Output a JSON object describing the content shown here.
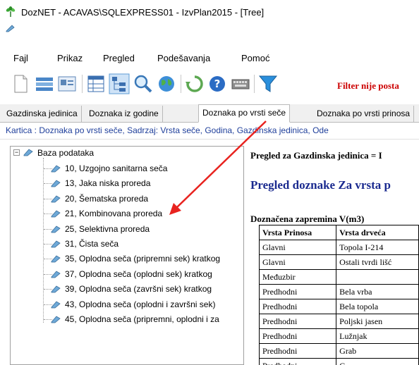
{
  "window": {
    "title": "DozNET - ACAVAS\\SQLEXPRESS01 - IzvPlan2015 - [Tree]",
    "icon": "app-leaf-icon"
  },
  "menu": {
    "items": [
      "Fajl",
      "Prikaz",
      "Pregled",
      "Podešavanja",
      "Pomoć"
    ]
  },
  "toolbar": {
    "icons": [
      "new-document-icon",
      "list-icon",
      "card-icon",
      "table-view-icon",
      "tree-view-icon",
      "search-icon",
      "globe-icon",
      "refresh-icon",
      "help-icon",
      "keyboard-icon",
      "filter-icon"
    ],
    "filter_label": "Filter nije posta"
  },
  "tabs": {
    "items": [
      "Gazdinska jedinica",
      "Doznaka iz godine",
      "Doznaka po vrsti seče",
      "Doznaka po vrsti prinosa"
    ],
    "active_index": 2
  },
  "kartica": {
    "text": "Kartica :  Doznaka po vrsti seče, Sadrzaj: Vrsta seče, Godina, Gazdinska jedinica, Ode"
  },
  "tree": {
    "root": "Baza podataka",
    "expander": "−",
    "items": [
      "10, Uzgojno sanitarna seča",
      "13, Jaka niska proreda",
      "20, Šematska proreda",
      "21, Kombinovana proreda",
      "25, Selektivna proreda",
      "31, Čista seča",
      "35, Oplodna seča (pripremni sek) kratkog",
      "37, Oplodna seča (oplodni sek) kratkog",
      "39, Oplodna seča (završni sek) kratkog",
      "43, Oplodna seča (oplodni i završni sek)",
      "45, Oplodna seča (pripremni, oplodni i za"
    ]
  },
  "report": {
    "pregled": "Pregled za Gazdinska jedinica = I",
    "heading": "Pregled doznake Za vrsta p",
    "sub": "Doznačena zapremina  V(m3)",
    "columns": [
      "Vrsta Prinosa",
      "Vrsta drveća"
    ],
    "rows": [
      [
        "Glavni",
        "Topola I-214"
      ],
      [
        "Glavni",
        "Ostali tvrdi lišć"
      ],
      [
        "Međuzbir",
        ""
      ],
      [
        "Predhodni",
        "Bela vrba"
      ],
      [
        "Predhodni",
        "Bela topola"
      ],
      [
        "Predhodni",
        "Poljski jasen"
      ],
      [
        "Predhodni",
        "Lužnjak"
      ],
      [
        "Predhodni",
        "Grab"
      ],
      [
        "Predhodni",
        "C"
      ]
    ]
  },
  "annotation": {
    "arrow_color": "#e8231f"
  }
}
